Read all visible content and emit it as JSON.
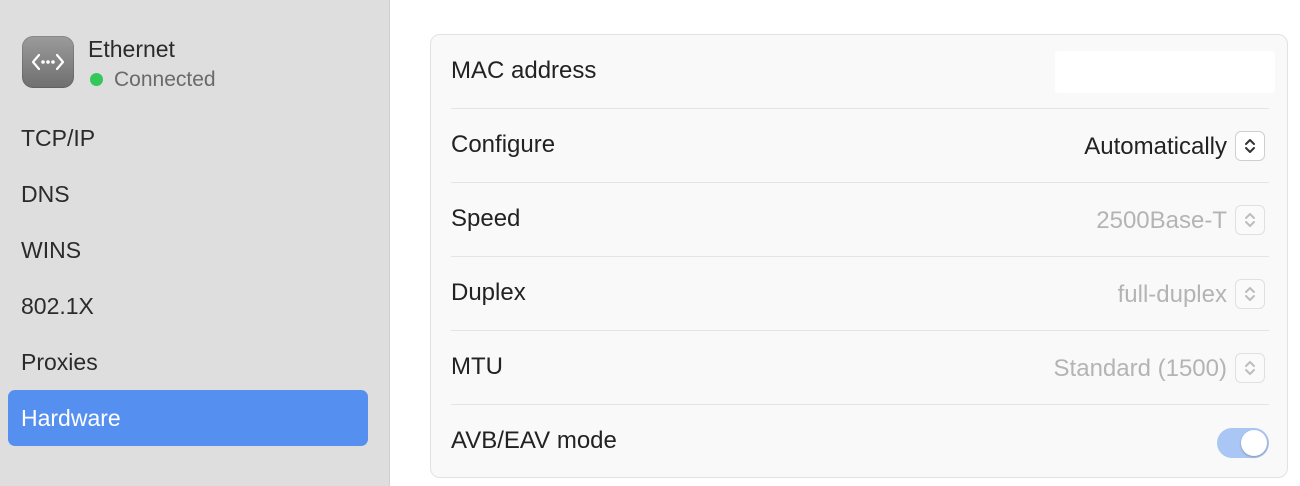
{
  "network": {
    "name": "Ethernet",
    "status": "Connected",
    "status_color": "#34c759",
    "icon": "ethernet-icon"
  },
  "sidebar": {
    "items": [
      {
        "label": "TCP/IP",
        "selected": false
      },
      {
        "label": "DNS",
        "selected": false
      },
      {
        "label": "WINS",
        "selected": false
      },
      {
        "label": "802.1X",
        "selected": false
      },
      {
        "label": "Proxies",
        "selected": false
      },
      {
        "label": "Hardware",
        "selected": true
      }
    ],
    "selected_color": "#5590f0"
  },
  "hardware": {
    "mac_address": {
      "label": "MAC address",
      "value": ""
    },
    "configure": {
      "label": "Configure",
      "value": "Automatically"
    },
    "speed": {
      "label": "Speed",
      "value": "2500Base-T"
    },
    "duplex": {
      "label": "Duplex",
      "value": "full-duplex"
    },
    "mtu": {
      "label": "MTU",
      "value": "Standard (1500)"
    },
    "avb_eav": {
      "label": "AVB/EAV mode",
      "enabled": true
    }
  }
}
